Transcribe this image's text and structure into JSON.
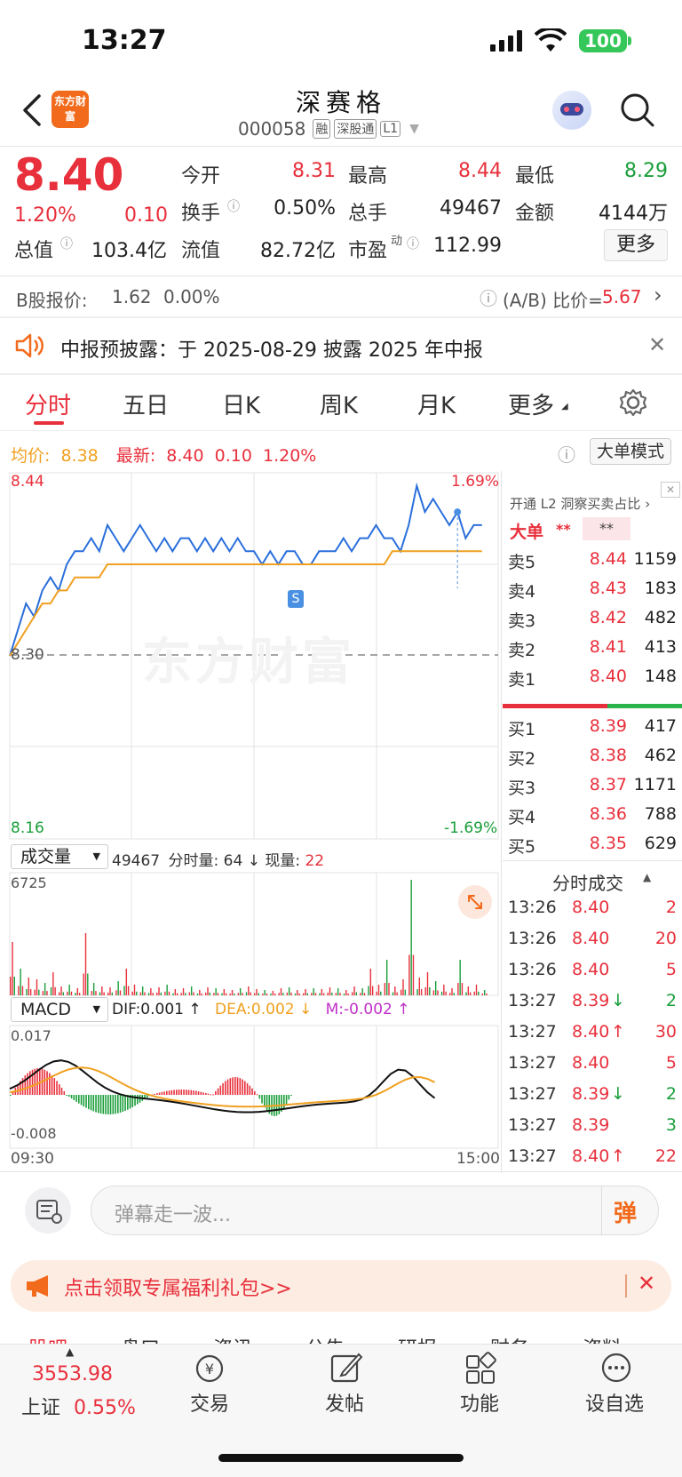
{
  "status": {
    "time": "13:27",
    "battery": "100"
  },
  "header": {
    "name": "深赛格",
    "code": "000058",
    "badges": [
      "融",
      "深股通",
      "L1"
    ],
    "logo_text": "东方财富"
  },
  "quote": {
    "price": "8.40",
    "change_pct": "1.20%",
    "change": "0.10",
    "open_label": "今开",
    "open": "8.31",
    "high_label": "最高",
    "high": "8.44",
    "low_label": "最低",
    "low": "8.29",
    "turnover_label": "换手",
    "turnover": "0.50%",
    "volume_label": "总手",
    "volume": "49467",
    "amount_label": "金额",
    "amount": "4144万",
    "mktcap_label": "总值",
    "mktcap": "103.4亿",
    "float_label": "流值",
    "float": "82.72亿",
    "pe_label": "市盈",
    "pe_sup": "动",
    "pe": "112.99",
    "more": "更多"
  },
  "bshare": {
    "label": "B股报价:",
    "price": "1.62",
    "pct": "0.00%",
    "ratio_label": "(A/B) 比价=",
    "ratio": "5.67"
  },
  "notice": {
    "text": "中报预披露：于 2025-08-29 披露 2025 年中报"
  },
  "tabs": [
    "分时",
    "五日",
    "日K",
    "周K",
    "月K",
    "更多"
  ],
  "chart_header": {
    "avg_label": "均价:",
    "avg": "8.38",
    "latest_label": "最新:",
    "latest": "8.40",
    "chg": "0.10",
    "pct": "1.20%",
    "mode": "大单模式"
  },
  "chart_labels": {
    "top_price": "8.44",
    "top_pct": "1.69%",
    "mid_price": "8.30",
    "bot_price": "8.16",
    "bot_pct": "-1.69%",
    "watermark": "东方财富",
    "marker": "S"
  },
  "volume_panel": {
    "selector": "成交量",
    "total": "49467",
    "fs_label": "分时量:",
    "fs": "64",
    "now_label": "现量:",
    "now": "22",
    "max": "6725"
  },
  "macd_panel": {
    "selector": "MACD",
    "dif": "DIF:0.001 ↑",
    "dea": "DEA:0.002 ↓",
    "m": "M:-0.002 ↑",
    "top": "0.017",
    "bottom": "-0.008",
    "start": "09:30",
    "end": "15:00"
  },
  "orderbook": {
    "promo": "开通 L2 洞察买卖占比",
    "big_label": "大单",
    "big_a": "**",
    "big_b": "**",
    "asks": [
      {
        "label": "卖5",
        "price": "8.44",
        "vol": "1159"
      },
      {
        "label": "卖4",
        "price": "8.43",
        "vol": "183"
      },
      {
        "label": "卖3",
        "price": "8.42",
        "vol": "482"
      },
      {
        "label": "卖2",
        "price": "8.41",
        "vol": "413"
      },
      {
        "label": "卖1",
        "price": "8.40",
        "vol": "148"
      }
    ],
    "bids": [
      {
        "label": "买1",
        "price": "8.39",
        "vol": "417"
      },
      {
        "label": "买2",
        "price": "8.38",
        "vol": "462"
      },
      {
        "label": "买3",
        "price": "8.37",
        "vol": "1171"
      },
      {
        "label": "买4",
        "price": "8.36",
        "vol": "788"
      },
      {
        "label": "买5",
        "price": "8.35",
        "vol": "629"
      }
    ]
  },
  "ticks": {
    "title": "分时成交",
    "rows": [
      {
        "time": "13:26",
        "price": "8.40",
        "dir": "",
        "vol": "2",
        "pc": "red",
        "vc": "red"
      },
      {
        "time": "13:26",
        "price": "8.40",
        "dir": "",
        "vol": "20",
        "pc": "red",
        "vc": "red"
      },
      {
        "time": "13:26",
        "price": "8.40",
        "dir": "",
        "vol": "5",
        "pc": "red",
        "vc": "red"
      },
      {
        "time": "13:27",
        "price": "8.39",
        "dir": "↓",
        "vol": "2",
        "pc": "red",
        "vc": "green"
      },
      {
        "time": "13:27",
        "price": "8.40",
        "dir": "↑",
        "vol": "30",
        "pc": "red",
        "vc": "red"
      },
      {
        "time": "13:27",
        "price": "8.40",
        "dir": "",
        "vol": "5",
        "pc": "red",
        "vc": "red"
      },
      {
        "time": "13:27",
        "price": "8.39",
        "dir": "↓",
        "vol": "2",
        "pc": "red",
        "vc": "green"
      },
      {
        "time": "13:27",
        "price": "8.39",
        "dir": "",
        "vol": "3",
        "pc": "red",
        "vc": "green"
      },
      {
        "time": "13:27",
        "price": "8.40",
        "dir": "↑",
        "vol": "22",
        "pc": "red",
        "vc": "red"
      }
    ]
  },
  "danmu": {
    "placeholder": "弹幕走一波...",
    "btn": "弹"
  },
  "banner": {
    "text": "点击领取专属福利礼包>>"
  },
  "subtabs": [
    "股吧",
    "盘口",
    "资讯",
    "公告",
    "研报",
    "财务",
    "资料"
  ],
  "bottom_nav": {
    "index_value": "3553.98",
    "index_name": "上证",
    "index_pct": "0.55%",
    "items": [
      "交易",
      "发帖",
      "功能",
      "设自选"
    ]
  },
  "chart_data": {
    "type": "line",
    "title": "",
    "xlabel": "",
    "ylabel": "",
    "ylim": [
      8.16,
      8.44
    ],
    "x_range": [
      "09:30",
      "15:00"
    ],
    "series": [
      {
        "name": "",
        "color": "#2a6fdb",
        "values": [
          8.3,
          8.32,
          8.34,
          8.33,
          8.35,
          8.36,
          8.35,
          8.37,
          8.38,
          8.38,
          8.39,
          8.38,
          8.4,
          8.39,
          8.38,
          8.39,
          8.4,
          8.39,
          8.38,
          8.39,
          8.38,
          8.39,
          8.39,
          8.38,
          8.39,
          8.38,
          8.39,
          8.38,
          8.39,
          8.38,
          8.38,
          8.37,
          8.38,
          8.37,
          8.38,
          8.38,
          8.37,
          8.37,
          8.38,
          8.38,
          8.38,
          8.39,
          8.38,
          8.39,
          8.39,
          8.4,
          8.39,
          8.39,
          8.38,
          8.4,
          8.43,
          8.41,
          8.42,
          8.41,
          8.4,
          8.41,
          8.39,
          8.4,
          8.4
        ]
      },
      {
        "name": "均价",
        "color": "#f0a020",
        "values": [
          8.3,
          8.31,
          8.32,
          8.33,
          8.34,
          8.34,
          8.35,
          8.35,
          8.36,
          8.36,
          8.36,
          8.36,
          8.37,
          8.37,
          8.37,
          8.37,
          8.37,
          8.37,
          8.37,
          8.37,
          8.37,
          8.37,
          8.37,
          8.37,
          8.37,
          8.37,
          8.37,
          8.37,
          8.37,
          8.37,
          8.37,
          8.37,
          8.37,
          8.37,
          8.37,
          8.37,
          8.37,
          8.37,
          8.37,
          8.37,
          8.37,
          8.37,
          8.37,
          8.37,
          8.37,
          8.37,
          8.37,
          8.38,
          8.38,
          8.38,
          8.38,
          8.38,
          8.38,
          8.38,
          8.38,
          8.38,
          8.38,
          8.38,
          8.38
        ]
      }
    ]
  }
}
